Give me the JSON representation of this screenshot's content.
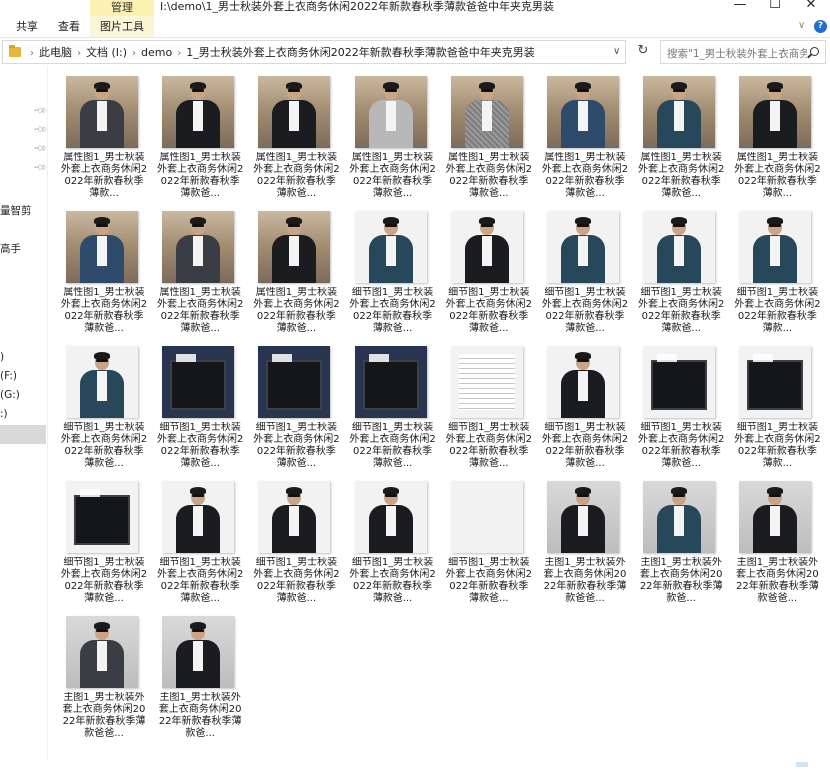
{
  "window": {
    "title": "I:\\demo\\1_男士秋装外套上衣商务休闲2022年新款春秋季薄款爸爸中年夹克男装",
    "context_tab": "管理",
    "minimize": "—",
    "maximize": "☐",
    "close": "✕"
  },
  "ribbon": {
    "tabs": [
      "共享",
      "查看",
      "图片工具"
    ],
    "collapse": "∨",
    "help": "?"
  },
  "address": {
    "crumbs": [
      "此电脑",
      "文档 (I:)",
      "demo",
      "1_男士秋装外套上衣商务休闲2022年新款春秋季薄款爸爸中年夹克男装"
    ],
    "dropdown": "∨",
    "refresh": "↻"
  },
  "search": {
    "placeholder": "搜索\"1_男士秋装外套上衣商务..."
  },
  "nav": {
    "items": [
      "量智剪",
      "高手",
      ")",
      "(F:)",
      "(G:)",
      ":)"
    ]
  },
  "files": [
    {
      "name": "属性图1_男士秋装外套上衣商务休闲2022年新款春秋季薄款...",
      "thumb": "street",
      "jacket": "dkgrey"
    },
    {
      "name": "属性图1_男士秋装外套上衣商务休闲2022年新款春秋季薄款爸...",
      "thumb": "street",
      "jacket": "black"
    },
    {
      "name": "属性图1_男士秋装外套上衣商务休闲2022年新款春秋季薄款爸...",
      "thumb": "street",
      "jacket": "black"
    },
    {
      "name": "属性图1_男士秋装外套上衣商务休闲2022年新款春秋季薄款爸...",
      "thumb": "street",
      "jacket": "grey"
    },
    {
      "name": "属性图1_男士秋装外套上衣商务休闲2022年新款春秋季薄款爸...",
      "thumb": "street",
      "jacket": "check"
    },
    {
      "name": "属性图1_男士秋装外套上衣商务休闲2022年新款春秋季薄款爸...",
      "thumb": "street",
      "jacket": "blue"
    },
    {
      "name": "属性图1_男士秋装外套上衣商务休闲2022年新款春秋季薄款爸...",
      "thumb": "street",
      "jacket": "teal"
    },
    {
      "name": "属性图1_男士秋装外套上衣商务休闲2022年新款春秋季薄款...",
      "thumb": "street",
      "jacket": "black"
    },
    {
      "name": "属性图1_男士秋装外套上衣商务休闲2022年新款春秋季薄款爸...",
      "thumb": "street",
      "jacket": "blue"
    },
    {
      "name": "属性图1_男士秋装外套上衣商务休闲2022年新款春秋季薄款爸...",
      "thumb": "street",
      "jacket": "dkgrey"
    },
    {
      "name": "属性图1_男士秋装外套上衣商务休闲2022年新款春秋季薄款爸...",
      "thumb": "street",
      "jacket": "black"
    },
    {
      "name": "细节图1_男士秋装外套上衣商务休闲2022年新款春秋季薄款爸...",
      "thumb": "light",
      "jacket": "teal"
    },
    {
      "name": "细节图1_男士秋装外套上衣商务休闲2022年新款春秋季薄款爸...",
      "thumb": "light",
      "jacket": "black"
    },
    {
      "name": "细节图1_男士秋装外套上衣商务休闲2022年新款春秋季薄款爸...",
      "thumb": "light",
      "jacket": "teal"
    },
    {
      "name": "细节图1_男士秋装外套上衣商务休闲2022年新款春秋季薄款爸...",
      "thumb": "light",
      "jacket": "teal"
    },
    {
      "name": "细节图1_男士秋装外套上衣商务休闲2022年新款春秋季薄款...",
      "thumb": "light",
      "jacket": "teal"
    },
    {
      "name": "细节图1_男士秋装外套上衣商务休闲2022年新款春秋季薄款爸...",
      "thumb": "light",
      "jacket": "teal"
    },
    {
      "name": "细节图1_男士秋装外套上衣商务休闲2022年新款春秋季薄款爸...",
      "thumb": "navy",
      "jacket": "fabric"
    },
    {
      "name": "细节图1_男士秋装外套上衣商务休闲2022年新款春秋季薄款爸...",
      "thumb": "navy",
      "jacket": "fabric"
    },
    {
      "name": "细节图1_男士秋装外套上衣商务休闲2022年新款春秋季薄款爸...",
      "thumb": "navy",
      "jacket": "fabric"
    },
    {
      "name": "细节图1_男士秋装外套上衣商务休闲2022年新款春秋季薄款爸...",
      "thumb": "sheet",
      "jacket": "none"
    },
    {
      "name": "细节图1_男士秋装外套上衣商务休闲2022年新款春秋季薄款爸...",
      "thumb": "light",
      "jacket": "black"
    },
    {
      "name": "细节图1_男士秋装外套上衣商务休闲2022年新款春秋季薄款爸...",
      "thumb": "light",
      "jacket": "fabric"
    },
    {
      "name": "细节图1_男士秋装外套上衣商务休闲2022年新款春秋季薄款...",
      "thumb": "light",
      "jacket": "fabric"
    },
    {
      "name": "细节图1_男士秋装外套上衣商务休闲2022年新款春秋季薄款爸...",
      "thumb": "light",
      "jacket": "fabric"
    },
    {
      "name": "细节图1_男士秋装外套上衣商务休闲2022年新款春秋季薄款爸...",
      "thumb": "light",
      "jacket": "black"
    },
    {
      "name": "细节图1_男士秋装外套上衣商务休闲2022年新款春秋季薄款爸...",
      "thumb": "light",
      "jacket": "black"
    },
    {
      "name": "细节图1_男士秋装外套上衣商务休闲2022年新款春秋季薄款爸...",
      "thumb": "light",
      "jacket": "black"
    },
    {
      "name": "细节图1_男士秋装外套上衣商务休闲2022年新款春秋季薄款爸...",
      "thumb": "blank",
      "jacket": "none"
    },
    {
      "name": "主图1_男士秋装外套上衣商务休闲2022年新款春秋季薄款爸爸...",
      "thumb": "grey",
      "jacket": "black"
    },
    {
      "name": "主图1_男士秋装外套上衣商务休闲2022年新款春秋季薄款爸...",
      "thumb": "grey",
      "jacket": "teal"
    },
    {
      "name": "主图1_男士秋装外套上衣商务休闲2022年新款春秋季薄款爸爸...",
      "thumb": "grey",
      "jacket": "black"
    },
    {
      "name": "主图1_男士秋装外套上衣商务休闲2022年新款春秋季薄款爸爸...",
      "thumb": "grey",
      "jacket": "dkgrey"
    },
    {
      "name": "主图1_男士秋装外套上衣商务休闲2022年新款春秋季薄款爸...",
      "thumb": "grey",
      "jacket": "black"
    }
  ],
  "colors": {
    "context_tab": "#fbf1b0",
    "selected_nav": "#d9d9d9",
    "folder": "#e8b53b"
  }
}
